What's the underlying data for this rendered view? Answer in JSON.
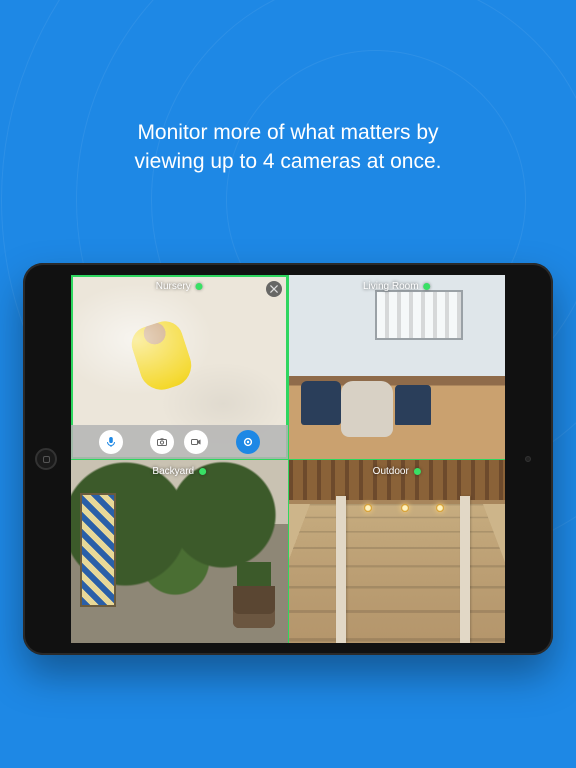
{
  "headline": {
    "line1": "Monitor more of what matters by",
    "line2": "viewing up to 4 cameras at once."
  },
  "feeds": [
    {
      "label": "Nursery",
      "status": "online",
      "selected": true
    },
    {
      "label": "Living Room",
      "status": "online",
      "selected": false
    },
    {
      "label": "Backyard",
      "status": "online",
      "selected": false
    },
    {
      "label": "Outdoor",
      "status": "online",
      "selected": false
    }
  ],
  "controls": {
    "mic_label": "mic",
    "camera_label": "snapshot",
    "record_label": "record",
    "more_label": "more"
  }
}
